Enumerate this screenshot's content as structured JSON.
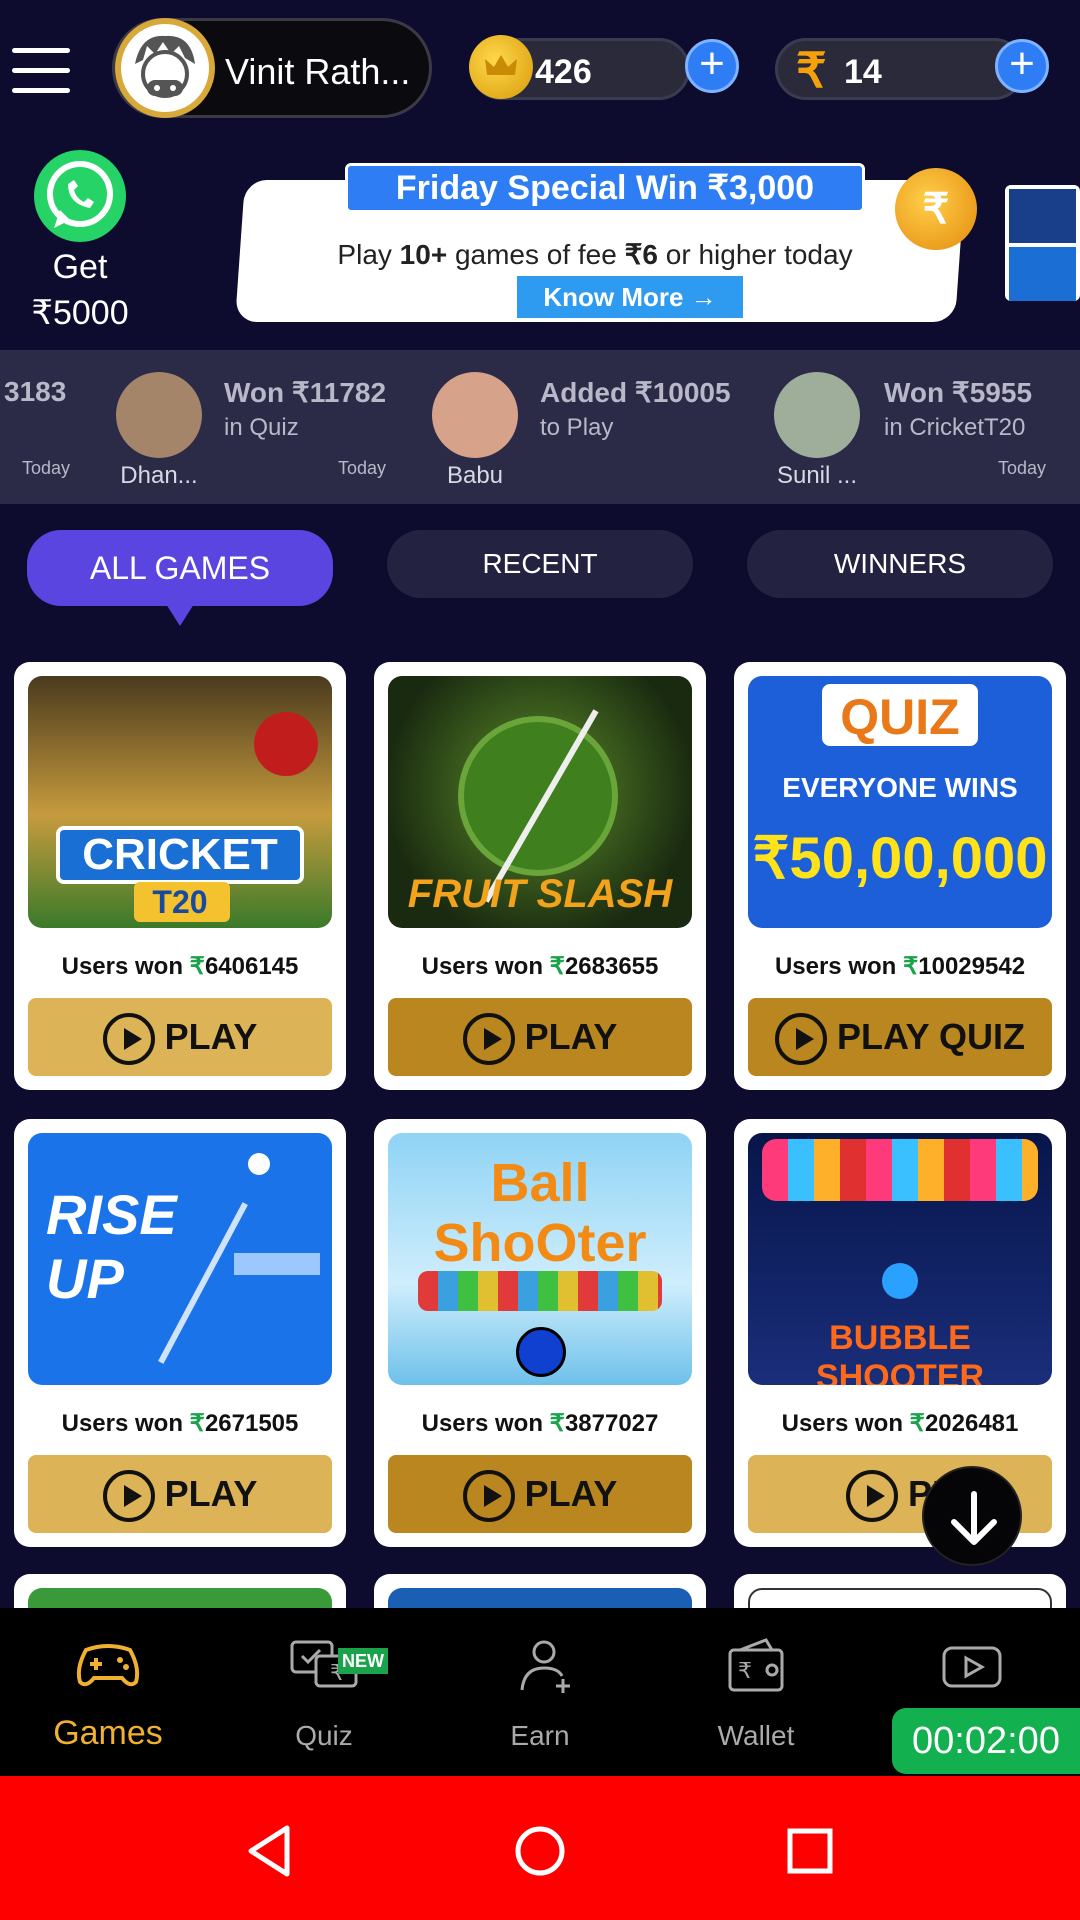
{
  "header": {
    "user_name": "Vinit Rath...",
    "coins": "426",
    "rupee_symbol": "₹",
    "rupee_balance": "14"
  },
  "promo": {
    "whatsapp_line1": "Get",
    "whatsapp_line2": "₹5000",
    "banner_title": "Friday Special Win ₹3,000",
    "banner_text_pre": "Play ",
    "banner_text_bold": "10+",
    "banner_text_mid": " games of fee ",
    "banner_text_bold2": "₹6",
    "banner_text_post": " or higher today",
    "banner_button": "Know More →",
    "banner_coin": "₹"
  },
  "ticker": [
    {
      "title": "3183",
      "sub": "",
      "name": "",
      "date": "Today"
    },
    {
      "title": "Won ₹11782",
      "sub": "in Quiz",
      "name": "Dhan...",
      "date": "Today"
    },
    {
      "title": "Added ₹10005",
      "sub": "to Play",
      "name": "Babu",
      "date": ""
    },
    {
      "title": "Won ₹5955",
      "sub": "in CricketT20",
      "name": "Sunil ...",
      "date": "Today"
    }
  ],
  "tabs": [
    "ALL GAMES",
    "RECENT",
    "WINNERS"
  ],
  "games": [
    {
      "thumb_text": "CRICKET",
      "thumb_sub": "T20",
      "won_prefix": "Users won ",
      "rupee": "₹",
      "won_amount": "6406145",
      "play_label": "PLAY"
    },
    {
      "thumb_text": "FRUIT SLASH",
      "thumb_sub": "",
      "won_prefix": "Users won ",
      "rupee": "₹",
      "won_amount": "2683655",
      "play_label": "PLAY"
    },
    {
      "thumb_text": "QUIZ",
      "thumb_sub": "EVERYONE WINS",
      "thumb_sub2": "₹50,00,000",
      "won_prefix": "Users won ",
      "rupee": "₹",
      "won_amount": "10029542",
      "play_label": "PLAY QUIZ"
    },
    {
      "thumb_text": "RISE UP",
      "thumb_sub": "",
      "won_prefix": "Users won ",
      "rupee": "₹",
      "won_amount": "2671505",
      "play_label": "PLAY"
    },
    {
      "thumb_text": "Ball ShoOter",
      "thumb_sub": "",
      "won_prefix": "Users won ",
      "rupee": "₹",
      "won_amount": "3877027",
      "play_label": "PLAY"
    },
    {
      "thumb_text": "BUBBLE SHOOTER",
      "thumb_sub": "",
      "won_prefix": "Users won ",
      "rupee": "₹",
      "won_amount": "2026481",
      "play_label": "PL"
    }
  ],
  "bottom_nav": {
    "items": [
      "Games",
      "Quiz",
      "Earn",
      "Wallet",
      ""
    ],
    "quiz_badge": "NEW",
    "timer": "00:02:00"
  },
  "colors": {
    "background": "#0d0b2e",
    "accent_purple": "#5b45e0",
    "play_gold": "#dcb457",
    "play_dark_gold": "#b9861f",
    "nav_active": "#f0b030",
    "system_bar": "#ff0000"
  }
}
